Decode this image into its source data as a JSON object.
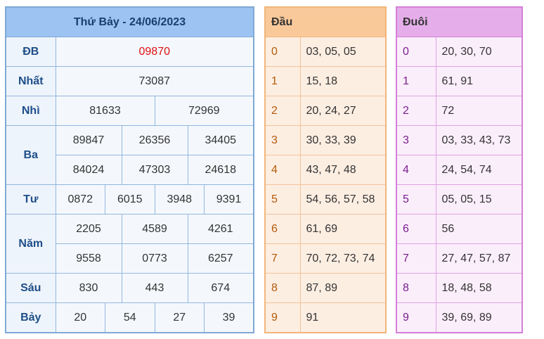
{
  "result": {
    "title": "Thứ Bảy - 24/06/2023",
    "prizes": {
      "db": {
        "label": "ĐB",
        "values": [
          "09870"
        ]
      },
      "nhat": {
        "label": "Nhất",
        "values": [
          "73087"
        ]
      },
      "nhi": {
        "label": "Nhì",
        "values": [
          "81633",
          "72969"
        ]
      },
      "ba": {
        "label": "Ba",
        "values": [
          "89847",
          "26356",
          "34405",
          "84024",
          "47303",
          "24618"
        ]
      },
      "tu": {
        "label": "Tư",
        "values": [
          "0872",
          "6015",
          "3948",
          "9391"
        ]
      },
      "nam": {
        "label": "Năm",
        "values": [
          "2205",
          "4589",
          "4261",
          "9558",
          "0773",
          "6257"
        ]
      },
      "sau": {
        "label": "Sáu",
        "values": [
          "830",
          "443",
          "674"
        ]
      },
      "bay": {
        "label": "Bảy",
        "values": [
          "20",
          "54",
          "27",
          "39"
        ]
      }
    }
  },
  "dau": {
    "header": "Đầu",
    "rows": [
      {
        "idx": "0",
        "val": "03, 05, 05"
      },
      {
        "idx": "1",
        "val": "15, 18"
      },
      {
        "idx": "2",
        "val": "20, 24, 27"
      },
      {
        "idx": "3",
        "val": "30, 33, 39"
      },
      {
        "idx": "4",
        "val": "43, 47, 48"
      },
      {
        "idx": "5",
        "val": "54, 56, 57, 58"
      },
      {
        "idx": "6",
        "val": "61, 69"
      },
      {
        "idx": "7",
        "val": "70, 72, 73, 74"
      },
      {
        "idx": "8",
        "val": "87, 89"
      },
      {
        "idx": "9",
        "val": "91"
      }
    ]
  },
  "duoi": {
    "header": "Đuôi",
    "rows": [
      {
        "idx": "0",
        "val": "20, 30, 70"
      },
      {
        "idx": "1",
        "val": "61, 91"
      },
      {
        "idx": "2",
        "val": "72"
      },
      {
        "idx": "3",
        "val": "03, 33, 43, 73"
      },
      {
        "idx": "4",
        "val": "24, 54, 74"
      },
      {
        "idx": "5",
        "val": "05, 05, 15"
      },
      {
        "idx": "6",
        "val": "56"
      },
      {
        "idx": "7",
        "val": "27, 47, 57, 87"
      },
      {
        "idx": "8",
        "val": "18, 48, 58"
      },
      {
        "idx": "9",
        "val": "39, 69, 89"
      }
    ]
  },
  "colors": {
    "result_header": "#9cc3f2",
    "dau_header": "#f9c99a",
    "duoi_header": "#e5aeea",
    "special_prize": "#dd1111"
  }
}
